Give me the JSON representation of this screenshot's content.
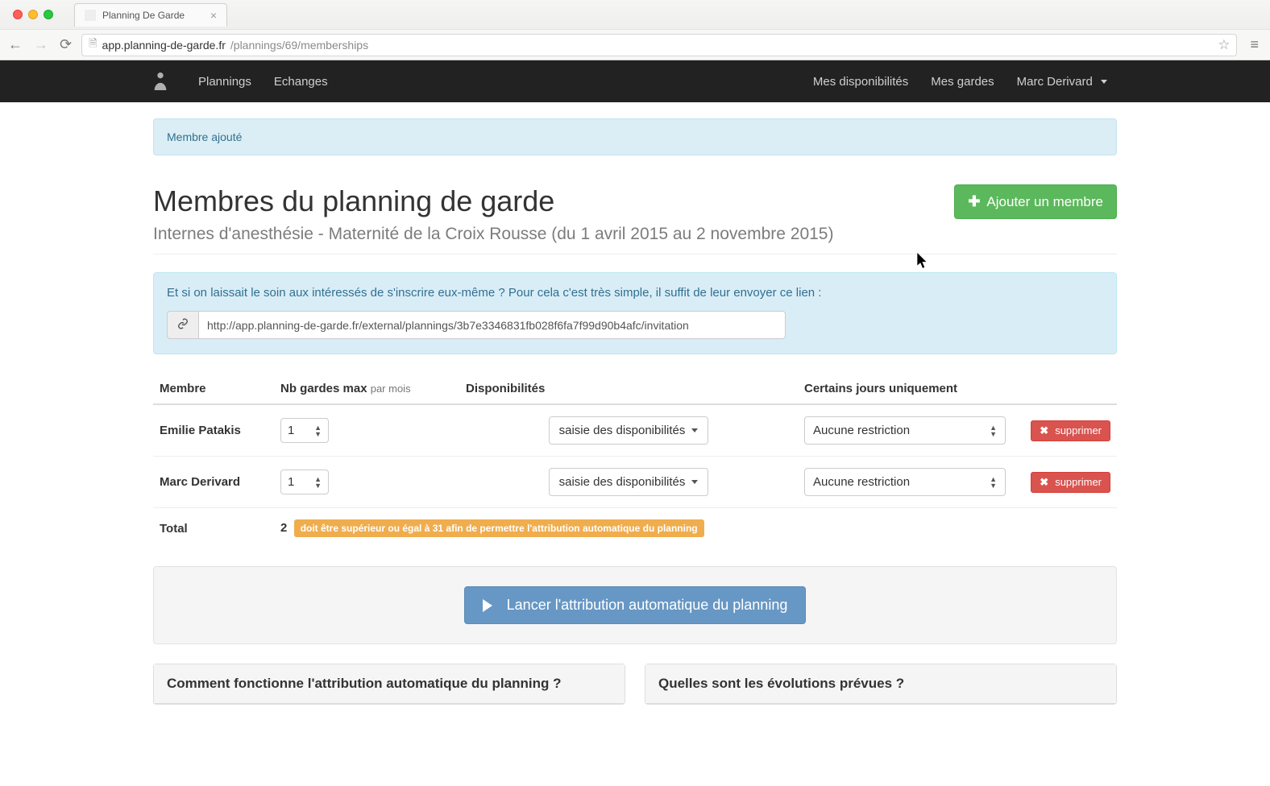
{
  "browser": {
    "tab_title": "Planning De Garde",
    "url_host": "app.planning-de-garde.fr",
    "url_path": "/plannings/69/memberships"
  },
  "nav": {
    "links": [
      "Plannings",
      "Echanges"
    ],
    "right_links": [
      "Mes disponibilités",
      "Mes gardes"
    ],
    "user": "Marc Derivard"
  },
  "flash": {
    "message": "Membre ajouté"
  },
  "header": {
    "title": "Membres du planning de garde",
    "subtitle": "Internes d'anesthésie - Maternité de la Croix Rousse (du 1 avril 2015 au 2 novembre 2015)",
    "add_button": "Ajouter un membre"
  },
  "invite": {
    "text": "Et si on laissait le soin aux intéressés de s'inscrire eux-même ? Pour cela c'est très simple, il suffit de leur envoyer ce lien :",
    "url": "http://app.planning-de-garde.fr/external/plannings/3b7e3346831fb028f6fa7f99d90b4afc/invitation"
  },
  "table": {
    "headers": {
      "member": "Membre",
      "max_gardes": "Nb gardes max",
      "max_gardes_suffix": "par mois",
      "dispo": "Disponibilités",
      "restrict": "Certains jours uniquement"
    },
    "rows": [
      {
        "name": "Emilie Patakis",
        "max": "1",
        "dispo": "saisie des disponibilités",
        "restrict": "Aucune restriction",
        "delete": "supprimer"
      },
      {
        "name": "Marc Derivard",
        "max": "1",
        "dispo": "saisie des disponibilités",
        "restrict": "Aucune restriction",
        "delete": "supprimer"
      }
    ],
    "total_label": "Total",
    "total_value": "2",
    "total_warning": "doit être supérieur ou égal à 31 afin de permettre l'attribution automatique du planning"
  },
  "launch": {
    "button": "Lancer l'attribution automatique du planning"
  },
  "panels": {
    "left": "Comment fonctionne l'attribution automatique du planning ?",
    "right": "Quelles sont les évolutions prévues ?"
  }
}
